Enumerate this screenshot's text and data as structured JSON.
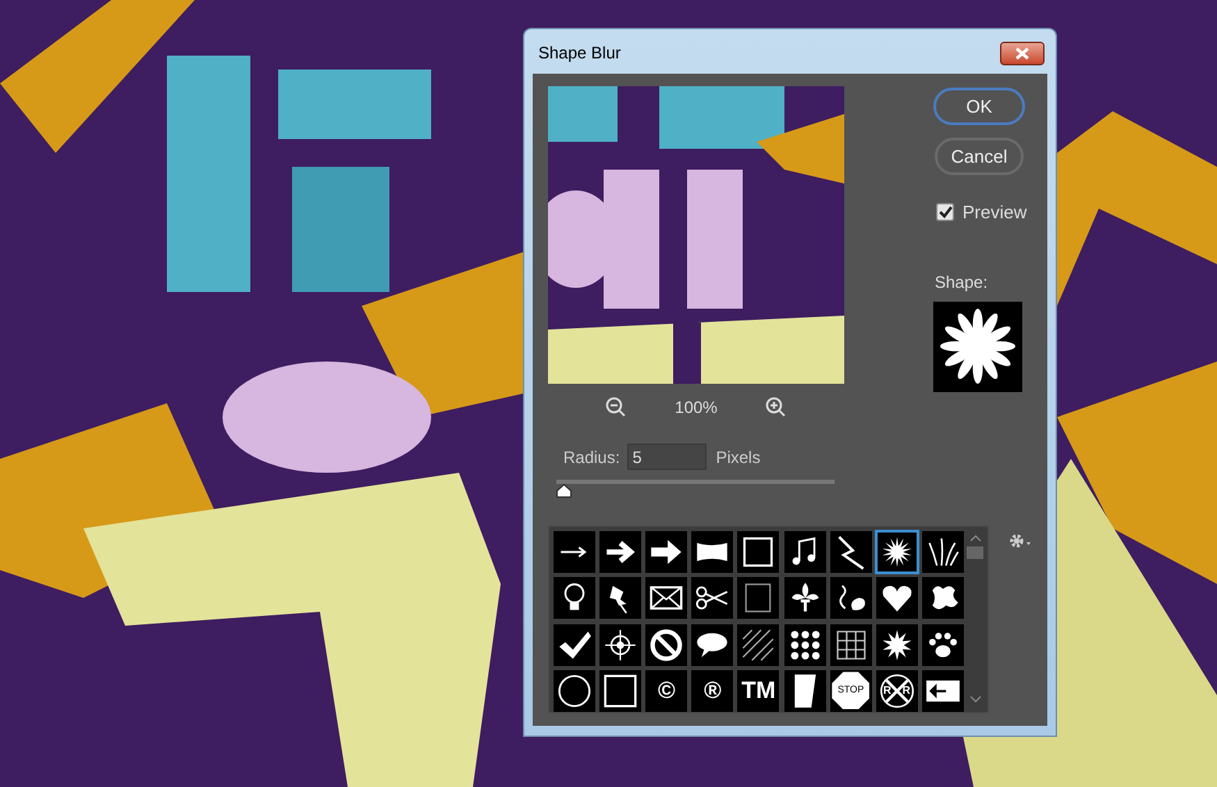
{
  "dialog": {
    "title": "Shape Blur",
    "zoom": "100%",
    "buttons": [
      {
        "label": "OK",
        "default": true
      },
      {
        "label": "Cancel",
        "default": false
      }
    ],
    "preview_checkbox": {
      "label": "Preview",
      "checked": true
    },
    "shape_label": "Shape:",
    "radius": {
      "label": "Radius:",
      "value": "5",
      "unit": "Pixels",
      "level": 0.0
    },
    "shapes": [
      {
        "kind": "thin-arrow",
        "selected": false
      },
      {
        "kind": "arrow",
        "selected": false
      },
      {
        "kind": "block-arrow",
        "selected": false
      },
      {
        "kind": "banner",
        "selected": false
      },
      {
        "kind": "frame",
        "selected": false
      },
      {
        "kind": "music-note",
        "selected": false
      },
      {
        "kind": "lightning",
        "selected": false
      },
      {
        "kind": "starburst",
        "selected": true
      },
      {
        "kind": "grass",
        "selected": false
      },
      {
        "kind": "lightbulb",
        "selected": false
      },
      {
        "kind": "pushpin",
        "selected": false
      },
      {
        "kind": "envelope",
        "selected": false
      },
      {
        "kind": "scissors",
        "selected": false
      },
      {
        "kind": "square-frame",
        "selected": false
      },
      {
        "kind": "fleur-de-lis",
        "selected": false
      },
      {
        "kind": "ornament",
        "selected": false
      },
      {
        "kind": "heart",
        "selected": false
      },
      {
        "kind": "blob",
        "selected": false
      },
      {
        "kind": "checkmark",
        "selected": false
      },
      {
        "kind": "crosshair",
        "selected": false
      },
      {
        "kind": "no-sign",
        "selected": false
      },
      {
        "kind": "speech-bubble",
        "selected": false
      },
      {
        "kind": "hatch",
        "selected": false
      },
      {
        "kind": "dots",
        "selected": false
      },
      {
        "kind": "grid",
        "selected": false
      },
      {
        "kind": "spiky-star",
        "selected": false
      },
      {
        "kind": "paw",
        "selected": false
      },
      {
        "kind": "circle",
        "selected": false
      },
      {
        "kind": "square",
        "selected": false
      },
      {
        "kind": "symbol",
        "text": "©",
        "selected": false
      },
      {
        "kind": "symbol",
        "text": "®",
        "selected": false
      },
      {
        "kind": "symbol",
        "text": "TM",
        "selected": false
      },
      {
        "kind": "bar",
        "selected": false
      },
      {
        "kind": "stop-sign",
        "text": "STOP",
        "selected": false
      },
      {
        "kind": "railroad-sign",
        "texts": [
          "R",
          "R"
        ],
        "selected": false
      },
      {
        "kind": "one-way-sign",
        "selected": false
      }
    ]
  }
}
